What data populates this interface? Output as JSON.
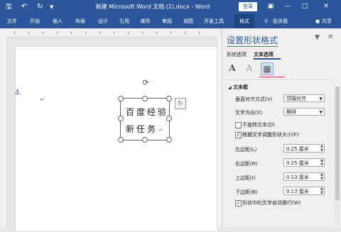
{
  "titlebar": {
    "save_icon": "save-icon",
    "undo_icon": "undo-icon",
    "redo_icon": "redo-icon",
    "title": "新建 Microsoft Word 文档 (2).docx - Word",
    "login": "登录"
  },
  "ribbon": {
    "tabs": [
      "文件",
      "开始",
      "插入",
      "布局",
      "设计",
      "引用",
      "邮件",
      "审阅",
      "视图",
      "开发工具",
      "格式"
    ],
    "active_tab": "格式",
    "tell_me": "告诉我",
    "share": "共享"
  },
  "document": {
    "shape_text_line1": "百度经验",
    "shape_text_line2": "新任务",
    "para_mark": "↵"
  },
  "pane": {
    "title": "设置形状格式",
    "tab_shape": "形状选项",
    "tab_text": "文本选项",
    "section_title": "文本框",
    "vertical_align_label": "垂直对齐方式(V)",
    "vertical_align_value": "顶端对齐",
    "text_direction_label": "文字方向(X)",
    "text_direction_value": "横排",
    "no_rotate_label": "不旋转文本(D)",
    "no_rotate_checked": false,
    "resize_label": "根据文字调整形状大小(F)",
    "resize_checked": true,
    "left_margin_label": "左边距(L)",
    "left_margin_value": "0.25 厘米",
    "right_margin_label": "右边距(R)",
    "right_margin_value": "0.25 厘米",
    "top_margin_label": "上边距(I)",
    "top_margin_value": "0.13 厘米",
    "bottom_margin_label": "下边距(B)",
    "bottom_margin_value": "0.13 厘米",
    "wrap_label": "形状中的文字自动换行(W)",
    "wrap_checked": true
  },
  "colors": {
    "accent": "#2b579a",
    "highlight": "#c0504d"
  }
}
